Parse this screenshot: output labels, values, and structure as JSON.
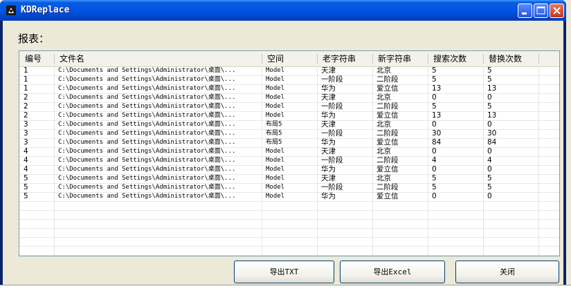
{
  "window": {
    "title": "KDReplace",
    "controls": {
      "minimize_icon": "minimize-icon",
      "maximize_icon": "maximize-icon",
      "close_icon": "close-icon"
    }
  },
  "report": {
    "label": "报表："
  },
  "table": {
    "columns": [
      "编号",
      "文件名",
      "空间",
      "老字符串",
      "新字符串",
      "搜索次数",
      "替换次数"
    ],
    "rows": [
      [
        "1",
        "C:\\Documents and Settings\\Administrator\\桌面\\...",
        "Model",
        "天津",
        "北京",
        "5",
        "5"
      ],
      [
        "1",
        "C:\\Documents and Settings\\Administrator\\桌面\\...",
        "Model",
        "一阶段",
        "二阶段",
        "5",
        "5"
      ],
      [
        "1",
        "C:\\Documents and Settings\\Administrator\\桌面\\...",
        "Model",
        "华为",
        "爱立信",
        "13",
        "13"
      ],
      [
        "2",
        "C:\\Documents and Settings\\Administrator\\桌面\\...",
        "Model",
        "天津",
        "北京",
        "0",
        "0"
      ],
      [
        "2",
        "C:\\Documents and Settings\\Administrator\\桌面\\...",
        "Model",
        "一阶段",
        "二阶段",
        "5",
        "5"
      ],
      [
        "2",
        "C:\\Documents and Settings\\Administrator\\桌面\\...",
        "Model",
        "华为",
        "爱立信",
        "13",
        "13"
      ],
      [
        "3",
        "C:\\Documents and Settings\\Administrator\\桌面\\...",
        "布局5",
        "天津",
        "北京",
        "0",
        "0"
      ],
      [
        "3",
        "C:\\Documents and Settings\\Administrator\\桌面\\...",
        "布局5",
        "一阶段",
        "二阶段",
        "30",
        "30"
      ],
      [
        "3",
        "C:\\Documents and Settings\\Administrator\\桌面\\...",
        "布局5",
        "华为",
        "爱立信",
        "84",
        "84"
      ],
      [
        "4",
        "C:\\Documents and Settings\\Administrator\\桌面\\...",
        "Model",
        "天津",
        "北京",
        "0",
        "0"
      ],
      [
        "4",
        "C:\\Documents and Settings\\Administrator\\桌面\\...",
        "Model",
        "一阶段",
        "二阶段",
        "4",
        "4"
      ],
      [
        "4",
        "C:\\Documents and Settings\\Administrator\\桌面\\...",
        "Model",
        "华为",
        "爱立信",
        "0",
        "0"
      ],
      [
        "5",
        "C:\\Documents and Settings\\Administrator\\桌面\\...",
        "Model",
        "天津",
        "北京",
        "5",
        "5"
      ],
      [
        "5",
        "C:\\Documents and Settings\\Administrator\\桌面\\...",
        "Model",
        "一阶段",
        "二阶段",
        "5",
        "5"
      ],
      [
        "5",
        "C:\\Documents and Settings\\Administrator\\桌面\\...",
        "Model",
        "华为",
        "爱立信",
        "0",
        "0"
      ]
    ]
  },
  "buttons": {
    "export_txt": "导出TXT",
    "export_excel": "导出Excel",
    "close": "关闭"
  }
}
